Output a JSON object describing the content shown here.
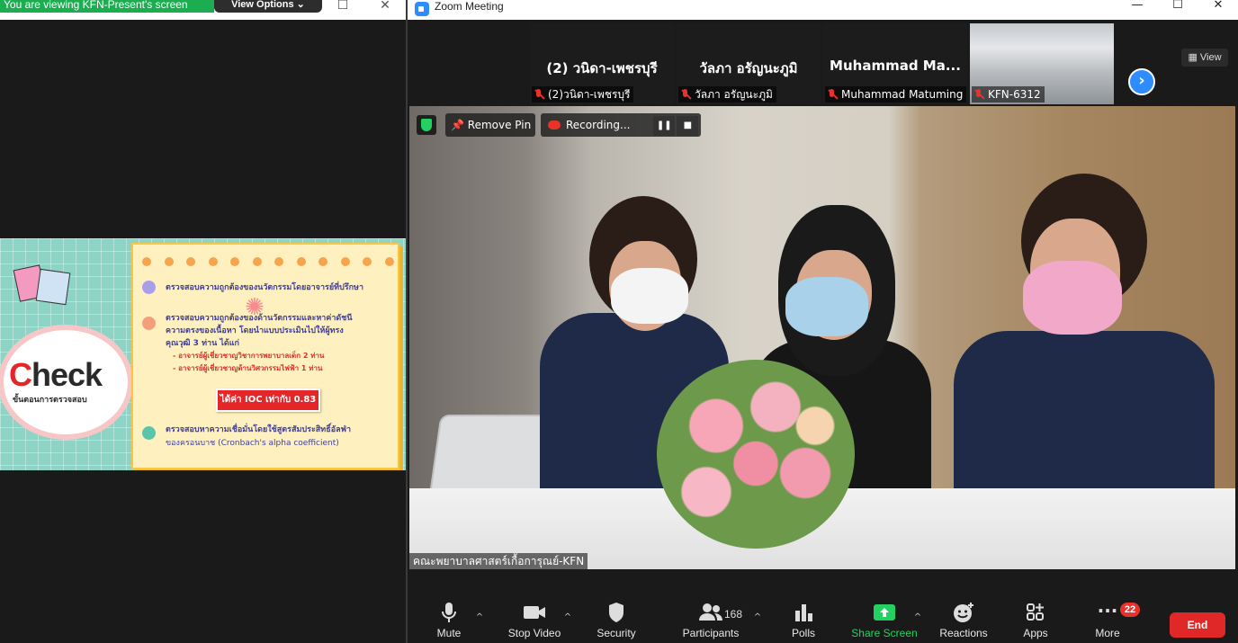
{
  "share_window": {
    "viewing_banner": "You are viewing KFN-Present's screen",
    "view_options_label": "View Options",
    "view_options_caret": "⌄",
    "maximize_glyph": "☐",
    "close_glyph": "✕",
    "slide": {
      "check_prefix": "C",
      "check_rest": "heck",
      "check_subtitle": "ขั้นตอนการตรวจสอบ",
      "item1": "ตรวจสอบความถูกต้องของนวัตกรรมโดยอาจารย์ที่ปรึกษา",
      "item2_line1": "ตรวจสอบความถูกต้องของด้านวัตกรรมและหาค่าดัชนี",
      "item2_line2": "ความตรงของเนื้อหา โดยนำแบบประเมินไปให้ผู้ทรง",
      "item2_line3": "คุณวุฒิ 3 ท่าน ได้แก่",
      "expert1": "-  อาจารย์ผู้เชี่ยวชาญวิชาการพยาบาลเด็ก 2 ท่าน",
      "expert2": "-  อาจารย์ผู้เชี่ยวชาญด้านวิศวกรรมไฟฟ้า 1 ท่าน",
      "ioc_label": "ได้ค่า IOC เท่ากับ 0.83",
      "item3_line1": "ตรวจสอบหาความเชื่อมั่นโดยใช้สูตรสัมประสิทธิ์อัลฟ่า",
      "item3_line2": "ของครอนบาช (Cronbach's alpha coefficient)",
      "colors": {
        "bullet1": "#a99ee8",
        "bullet2": "#f2a07b",
        "bullet3": "#5cc4a8"
      }
    }
  },
  "zoom": {
    "title": "Zoom Meeting",
    "minimize_glyph": "—",
    "maximize_glyph": "☐",
    "close_glyph": "✕",
    "view_label": "View",
    "view_icon": "grid-icon",
    "next_glyph": "›",
    "participants": [
      {
        "tile_name": "(2) วนิดา-เพชรบุรี",
        "footer": "(2)วนิดา-เพชรบุรี",
        "muted": true
      },
      {
        "tile_name": "วัลภา อรัญนะภูมิ",
        "footer": "วัลภา อรัญนะภูมิ",
        "muted": true
      },
      {
        "tile_name": "Muhammad  Ma...",
        "footer": "Muhammad Matuming",
        "muted": true
      },
      {
        "tile_name": "",
        "footer": "KFN-6312",
        "muted": true
      }
    ],
    "video": {
      "remove_pin_label": "Remove Pin",
      "recording_label": "Recording...",
      "pause_glyph": "❚❚",
      "stop_glyph": "■",
      "speaker_caption": "คณะพยาบาลศาสตร์เกื้อการุณย์-KFN"
    },
    "toolbar": {
      "mute": "Mute",
      "stop_video": "Stop Video",
      "security": "Security",
      "participants": "Participants",
      "participants_count": "168",
      "polls": "Polls",
      "share_screen": "Share Screen",
      "reactions": "Reactions",
      "apps": "Apps",
      "more": "More",
      "more_badge": "22",
      "end": "End",
      "caret": "^"
    },
    "colors": {
      "accent": "#2d8cff",
      "share_green": "#23d160",
      "end_red": "#e02828",
      "muted_red": "#e8322a"
    }
  }
}
